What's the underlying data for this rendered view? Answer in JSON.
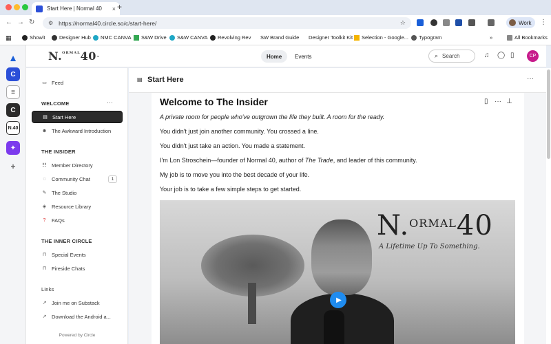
{
  "browser": {
    "tab_title": "Start Here | Normal 40",
    "tab_close": "×",
    "new_tab": "+",
    "url": "https://normal40.circle.so/c/start-here/",
    "profile_label": "Work",
    "bookmarks": [
      "Showit",
      "Designer Hub",
      "NMC CANVA",
      "S&W Drive",
      "S&W CANVA",
      "Revolving Rev",
      "SW Brand Guide",
      "Designer Toolkit Kit",
      "Selection - Google...",
      "Typogram"
    ],
    "more_bookmarks": "»",
    "all_bookmarks": "All Bookmarks"
  },
  "header": {
    "logo_main": "N.",
    "logo_sup": "ORMAL",
    "logo_num": "40",
    "nav": [
      "Home",
      "Events"
    ],
    "search_placeholder": "Search",
    "avatar_initials": "CP"
  },
  "sidebar": {
    "feed": "Feed",
    "welcome_title": "WELCOME",
    "welcome_more": "···",
    "welcome_items": [
      "Start Here",
      "The Awkward Introduction"
    ],
    "insider_title": "THE INSIDER",
    "insider_items": [
      "Member Directory",
      "Community Chat",
      "The Studio",
      "Resource Library",
      "FAQs"
    ],
    "community_chat_count": "1",
    "inner_title": "THE INNER CIRCLE",
    "inner_items": [
      "Special Events",
      "Fireside Chats"
    ],
    "links_title": "Links",
    "links_items": [
      "Join me on Substack",
      "Download the Android a..."
    ],
    "powered_by": "Powered by Circle"
  },
  "content": {
    "space_title": "Start Here",
    "more": "···",
    "post_title": "Welcome to The Insider",
    "intro_italic": "A private room for people who've outgrown the life they built. A room for the ready.",
    "p1": "You didn't just join another community. You crossed a line.",
    "p2": "You didn't just take an action. You made a statement.",
    "p3_a": "I'm Lon Stroschein—founder of Normal 40, author of ",
    "p3_b": "The Trade",
    "p3_c": ", and leader of this community.",
    "p4": "My job is to move you into the best decade of your life.",
    "p5": "Your job is to take a few simple steps to get started.",
    "video_logo_main": "N.",
    "video_logo_sup": "ORMAL",
    "video_logo_num": "40",
    "video_tagline": "A Lifetime Up To Something."
  },
  "colors": {
    "accent": "#1f8cf0",
    "avatar": "#c71a8b",
    "active_item": "#2b2b2b"
  }
}
